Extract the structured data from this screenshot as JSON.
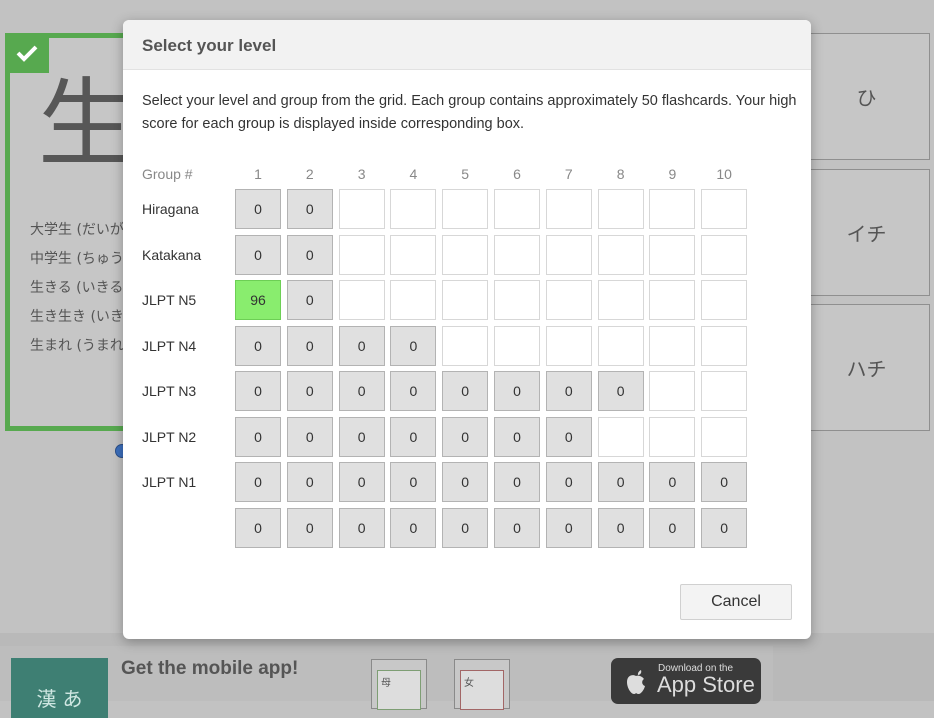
{
  "background": {
    "kanji": "生",
    "vocab": [
      "大学生 (だいが",
      "中学生 (ちゅう",
      "生きる (いきる",
      "生き生き (いき",
      "生まれ (うまれ"
    ],
    "answers": [
      "ひ",
      "イチ",
      "ハチ"
    ],
    "mobile_title": "Get the mobile app!",
    "logo_chars": [
      "漢",
      "あ"
    ],
    "phone1_char": "母",
    "phone2_char": "女",
    "appstore_small": "Download on the",
    "appstore_big": "App Store"
  },
  "modal": {
    "title": "Select your level",
    "description": "Select your level and group from the grid. Each group contains approximately 50 flashcards. Your high score for each group is displayed inside corresponding box.",
    "group_label": "Group #",
    "columns": [
      "1",
      "2",
      "3",
      "4",
      "5",
      "6",
      "7",
      "8",
      "9",
      "10"
    ],
    "rows": [
      {
        "label": "Hiragana",
        "cells": [
          "0",
          "0",
          null,
          null,
          null,
          null,
          null,
          null,
          null,
          null
        ]
      },
      {
        "label": "Katakana",
        "cells": [
          "0",
          "0",
          null,
          null,
          null,
          null,
          null,
          null,
          null,
          null
        ]
      },
      {
        "label": "JLPT N5",
        "cells": [
          "96",
          "0",
          null,
          null,
          null,
          null,
          null,
          null,
          null,
          null
        ],
        "high_index": 0
      },
      {
        "label": "JLPT N4",
        "cells": [
          "0",
          "0",
          "0",
          "0",
          null,
          null,
          null,
          null,
          null,
          null
        ]
      },
      {
        "label": "JLPT N3",
        "cells": [
          "0",
          "0",
          "0",
          "0",
          "0",
          "0",
          "0",
          "0",
          null,
          null
        ]
      },
      {
        "label": "JLPT N2",
        "cells": [
          "0",
          "0",
          "0",
          "0",
          "0",
          "0",
          "0",
          null,
          null,
          null
        ]
      },
      {
        "label": "JLPT N1",
        "cells": [
          "0",
          "0",
          "0",
          "0",
          "0",
          "0",
          "0",
          "0",
          "0",
          "0"
        ]
      },
      {
        "label": "",
        "cells": [
          "0",
          "0",
          "0",
          "0",
          "0",
          "0",
          "0",
          "0",
          "0",
          "0"
        ]
      }
    ],
    "cancel_label": "Cancel"
  },
  "colors": {
    "accent_green": "#57a94f",
    "high_score_green": "#89ed6e"
  }
}
